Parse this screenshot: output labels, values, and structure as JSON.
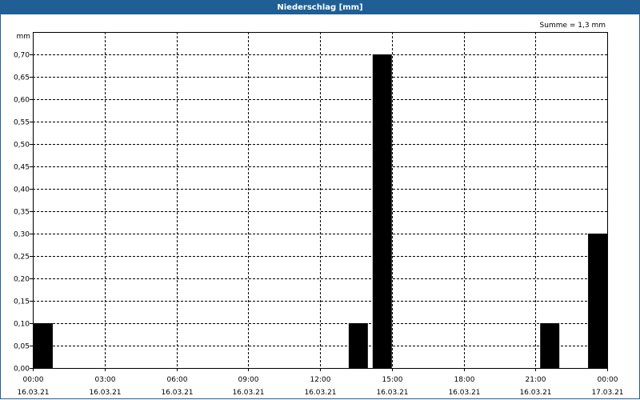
{
  "window": {
    "title": "Niederschlag [mm]"
  },
  "chart_data": {
    "type": "bar",
    "title": "Niederschlag [mm]",
    "ylabel": "mm",
    "annotation": "Summe = 1,3 mm",
    "ylim": [
      0,
      0.75
    ],
    "xlim_hours": [
      0,
      24
    ],
    "y_ticks": [
      "0,00",
      "0,05",
      "0,10",
      "0,15",
      "0,20",
      "0,25",
      "0,30",
      "0,35",
      "0,40",
      "0,45",
      "0,50",
      "0,55",
      "0,60",
      "0,65",
      "0,70"
    ],
    "x_ticks": [
      {
        "time": "00:00",
        "date": "16.03.21"
      },
      {
        "time": "03:00",
        "date": "16.03.21"
      },
      {
        "time": "06:00",
        "date": "16.03.21"
      },
      {
        "time": "09:00",
        "date": "16.03.21"
      },
      {
        "time": "12:00",
        "date": "16.03.21"
      },
      {
        "time": "15:00",
        "date": "16.03.21"
      },
      {
        "time": "18:00",
        "date": "16.03.21"
      },
      {
        "time": "21:00",
        "date": "16.03.21"
      },
      {
        "time": "00:00",
        "date": "17.03.21"
      }
    ],
    "bars": [
      {
        "start": "00:00",
        "end": "00:50",
        "value": 0.1
      },
      {
        "start": "13:10",
        "end": "14:00",
        "value": 0.1
      },
      {
        "start": "14:10",
        "end": "15:00",
        "value": 0.7
      },
      {
        "start": "21:10",
        "end": "22:00",
        "value": 0.1
      },
      {
        "start": "23:10",
        "end": "24:00",
        "value": 0.3
      }
    ],
    "grid": true,
    "bar_color": "#000000"
  }
}
